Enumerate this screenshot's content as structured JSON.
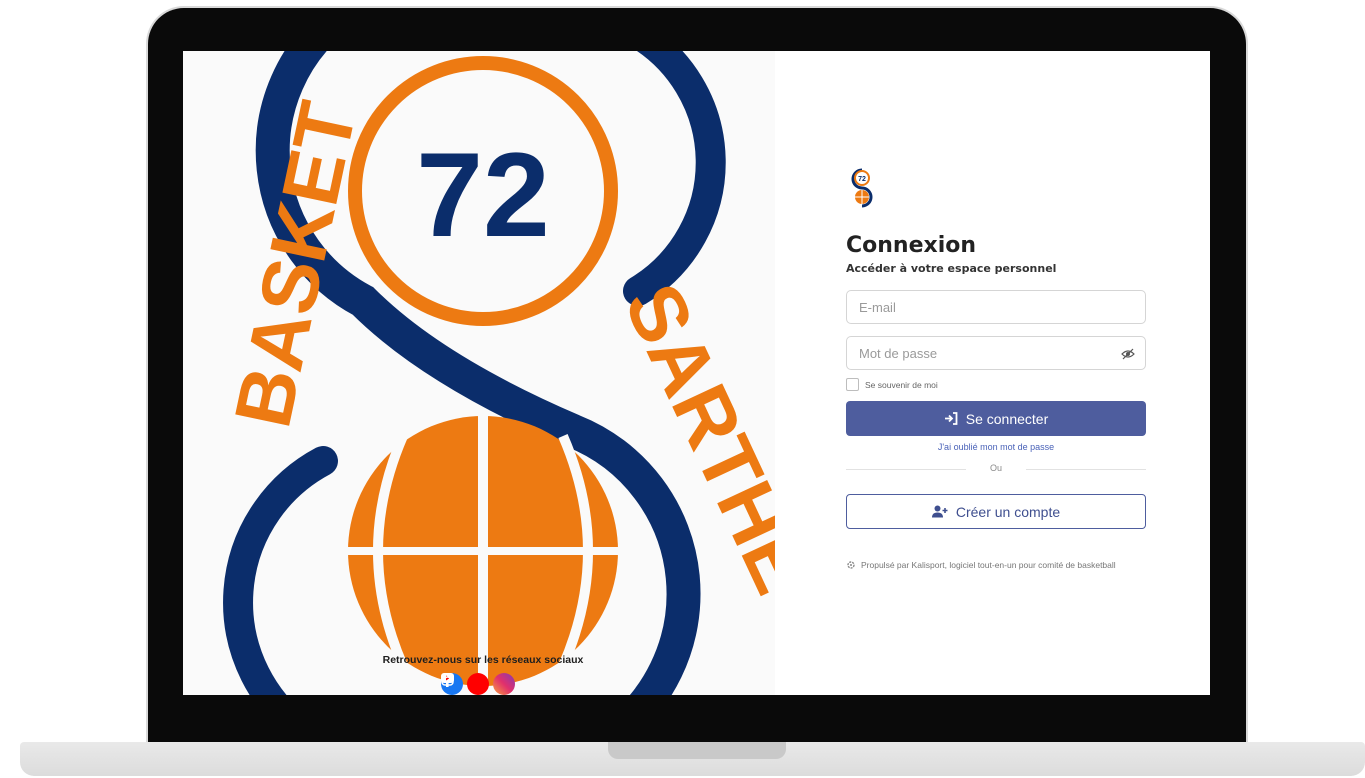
{
  "poster": {
    "number": "72",
    "arc_text_left": "BASKET",
    "arc_text_right": "SARTHE",
    "socials_caption": "Retrouvez-nous sur les réseaux sociaux",
    "socials": [
      "facebook-icon",
      "youtube-icon",
      "instagram-icon"
    ]
  },
  "brand": {
    "logo_number": "72"
  },
  "login": {
    "title": "Connexion",
    "subtitle": "Accéder à votre espace personnel",
    "email_placeholder": "E-mail",
    "email_value": "",
    "password_placeholder": "Mot de passe",
    "password_value": "",
    "remember_label": "Se souvenir de moi",
    "remember_checked": false,
    "submit_label": "Se connecter",
    "forgot_label": "J'ai oublié mon mot de passe",
    "or_label": "Ou",
    "create_account_label": "Créer un compte",
    "powered_by": "Propulsé par Kalisport, logiciel tout-en-un pour comité de basketball"
  },
  "colors": {
    "navy": "#0b2d6b",
    "orange": "#ed7a12",
    "primary_button": "#4e5d9e",
    "link": "#4a62b8"
  },
  "icons": {
    "eye": "eye-slash-icon",
    "login": "sign-in-icon",
    "create": "user-plus-icon",
    "powered": "gear-icon"
  }
}
